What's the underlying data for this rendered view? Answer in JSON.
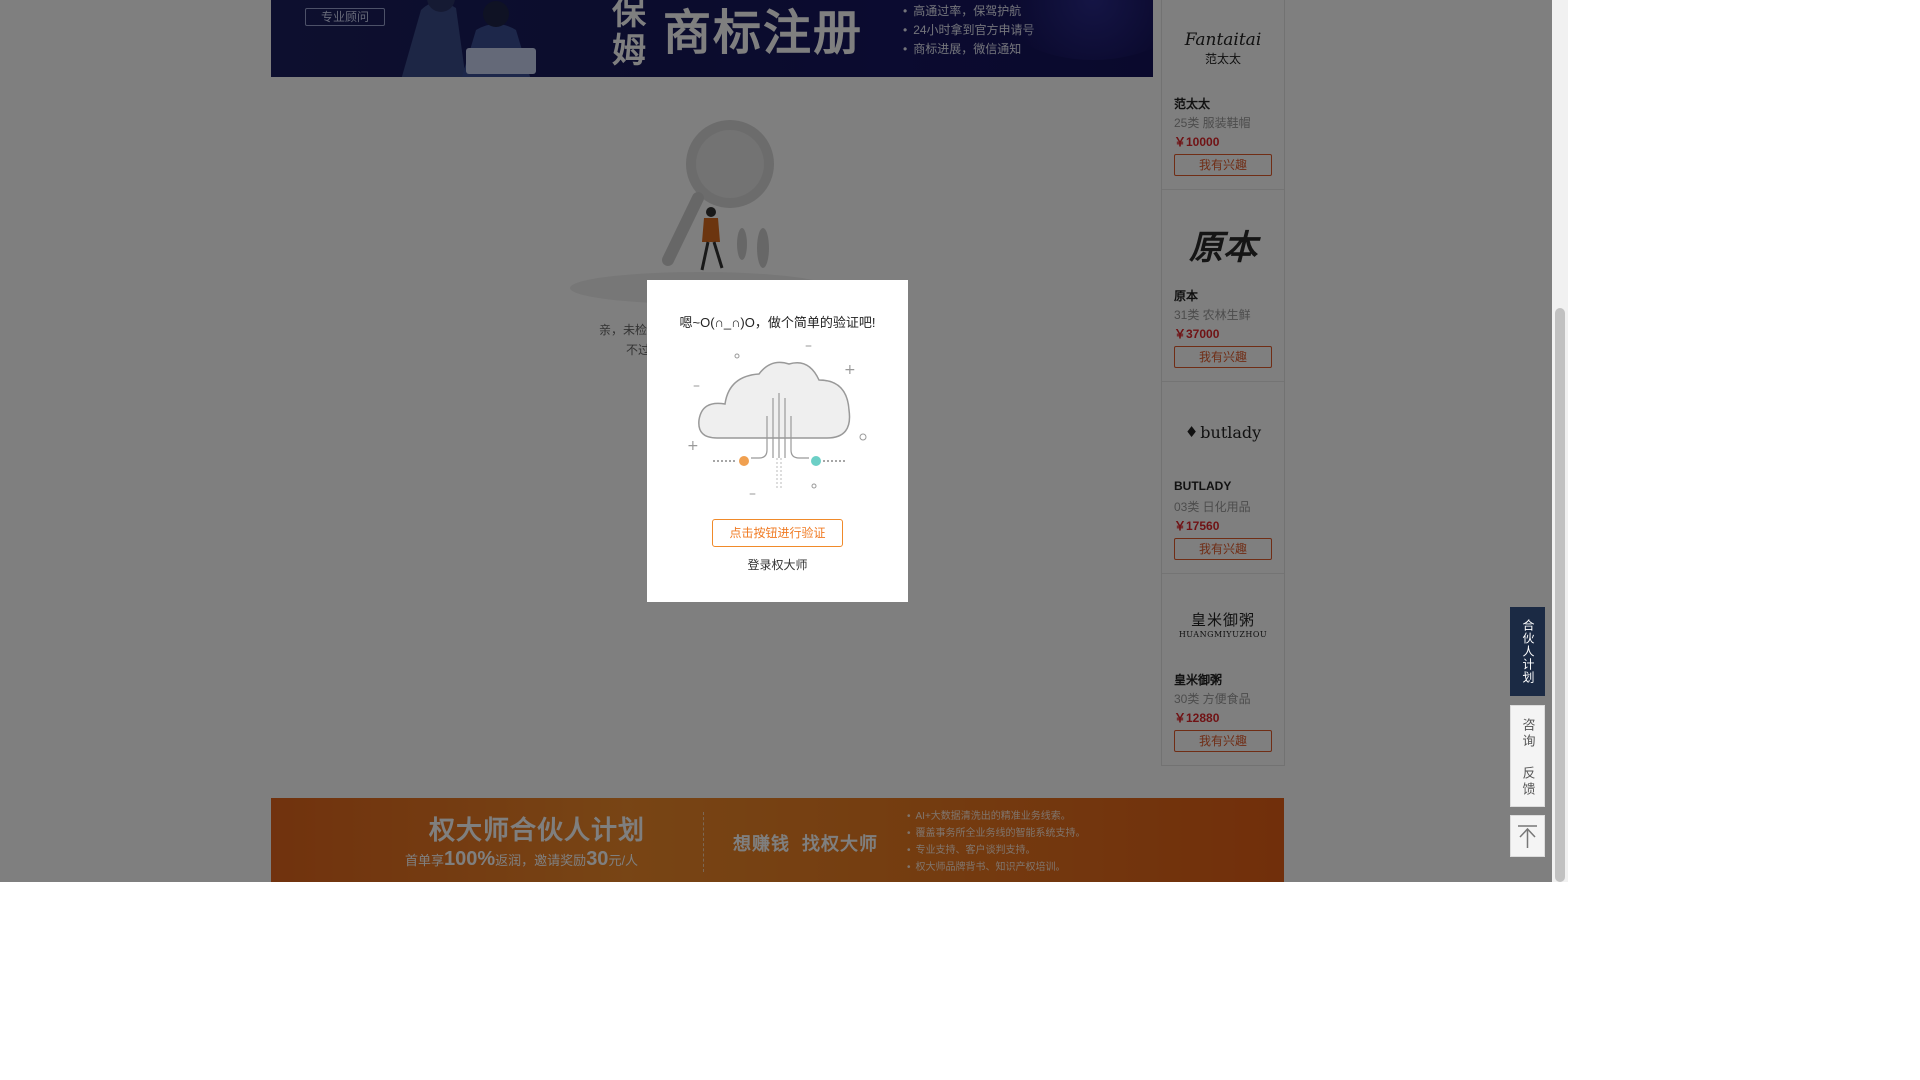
{
  "top_banner": {
    "advisor_tag": "专业顾问",
    "vertical_text": "保\n姆",
    "title": "商标注册",
    "bullets": [
      "高通过率，保驾护航",
      "24小时拿到官方申请号",
      "商标进展，微信通知"
    ]
  },
  "empty_state": {
    "line1": "亲，未检",
    "line2": "不过"
  },
  "sidebar": {
    "items": [
      {
        "logo_en": "Fantaitai",
        "logo_cn": "范太太",
        "name": "范太太",
        "category": "25类 服装鞋帽",
        "price": "￥10000",
        "button": "我有兴趣"
      },
      {
        "logo_cn": "原本",
        "name": "原本",
        "category": "31类 农林生鲜",
        "price": "￥37000",
        "button": "我有兴趣"
      },
      {
        "logo_en": "butlady",
        "name": "BUTLADY",
        "category": "03类 日化用品",
        "price": "￥17560",
        "button": "我有兴趣"
      },
      {
        "logo_cn": "皇米御粥",
        "logo_en": "HUANGMIYUZHOU",
        "name": "皇米御粥",
        "category": "30类 方便食品",
        "price": "￥12880",
        "button": "我有兴趣"
      }
    ]
  },
  "bottom_banner": {
    "title": "权大师合伙人计划",
    "sub_prefix": "首单享",
    "sub_pct": "100%",
    "sub_mid": "返润，邀请奖励",
    "sub_amount": "30",
    "sub_unit": "元/人",
    "slogan": "想赚钱  找权大师",
    "bullets": [
      "AI+大数据清洗出的精准业务线索。",
      "覆盖事务所全业务线的智能系统支持。",
      "专业支持、客户谈判支持。",
      "权大师品牌背书、知识产权培训。"
    ]
  },
  "float_tools": {
    "partner": "合伙人计划",
    "consult": "咨询",
    "feedback": "反馈"
  },
  "modal": {
    "title": "嗯~O(∩_∩)O，做个简单的验证吧!",
    "verify_button": "点击按钮进行验证",
    "login_link": "登录权大师"
  },
  "colors": {
    "accent_orange": "#f07a22",
    "price_red": "#e0262b",
    "banner_navy": "#17195a",
    "partner_dark": "#1b2a44"
  }
}
